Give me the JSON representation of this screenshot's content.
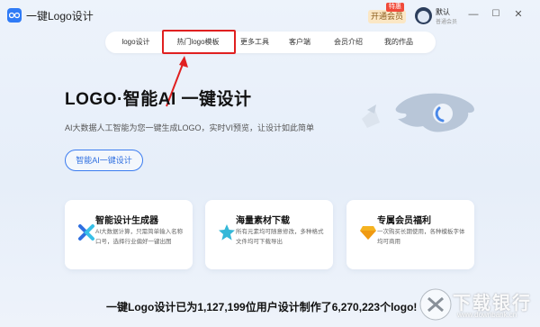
{
  "app": {
    "title": "一键Logo设计",
    "vip_button": "开通会员",
    "vip_tag": "特惠",
    "user_name": "默认",
    "user_level": "普通会员"
  },
  "window_controls": [
    "—",
    "☐",
    "✕"
  ],
  "nav": {
    "items": [
      "logo设计",
      "热门logo模板",
      "更多工具",
      "客户端",
      "会员介绍",
      "我的作品"
    ],
    "highlighted_index": 1,
    "highlight_color": "#e02020"
  },
  "hero": {
    "title": "LOGO·智能AI 一键设计",
    "subtitle": "AI大数据人工智能为您一键生成LOGO，实时VI预览，让设计如此简单",
    "button": "智能AI一键设计",
    "accent_color": "#2f6fe0"
  },
  "features": [
    {
      "title": "智能设计生成器",
      "desc": "AI大数据计算，只需简单输入名称口号，选择行业偏好一键出图",
      "icon": "x-sparkle-icon"
    },
    {
      "title": "海量素材下载",
      "desc": "所有元素均可随意修改，多种格式文件均可下载导出",
      "icon": "star-icon"
    },
    {
      "title": "专属会员福利",
      "desc": "一次购买长期使用，各种模板字体均可商用",
      "icon": "diamond-icon"
    }
  ],
  "stats_text": "一键Logo设计已为1,127,199位用户设计制作了6,270,223个logo!",
  "watermark": {
    "text": "下载银行",
    "url": "www.downbank.cn"
  }
}
